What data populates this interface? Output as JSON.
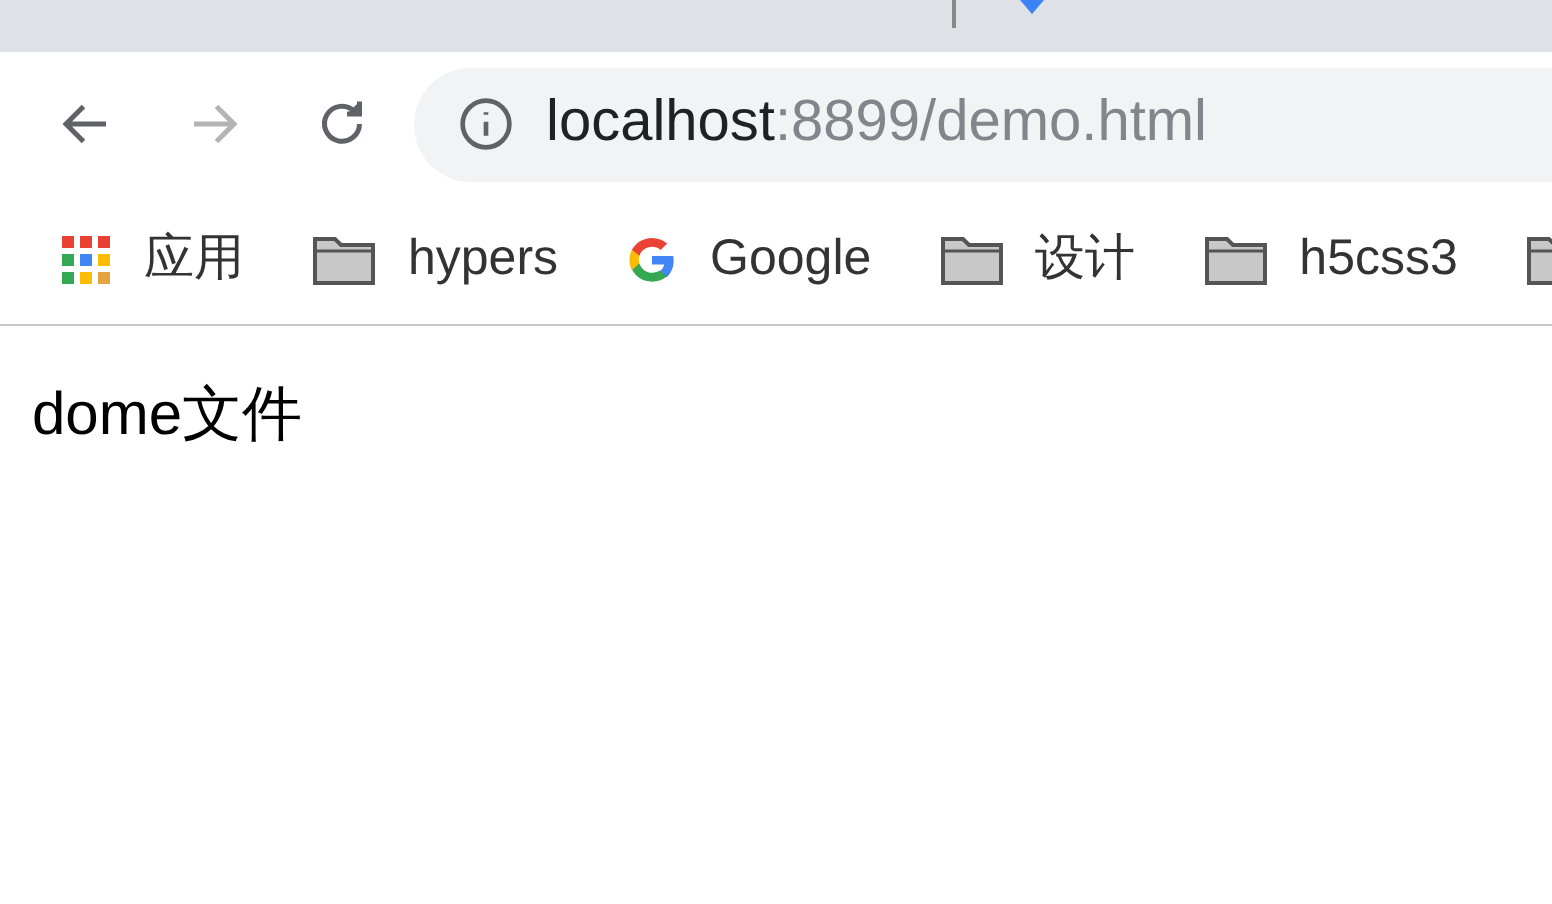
{
  "toolbar": {
    "back": {
      "disabled": false
    },
    "forward": {
      "disabled": true
    },
    "address": {
      "host": "localhost",
      "rest": ":8899/demo.html"
    }
  },
  "bookmarks": [
    {
      "kind": "apps",
      "label": "应用"
    },
    {
      "kind": "folder",
      "label": "hypers"
    },
    {
      "kind": "google",
      "label": "Google"
    },
    {
      "kind": "folder",
      "label": "设计"
    },
    {
      "kind": "folder",
      "label": "h5css3"
    },
    {
      "kind": "folder"
    }
  ],
  "page": {
    "text": "dome文件"
  }
}
